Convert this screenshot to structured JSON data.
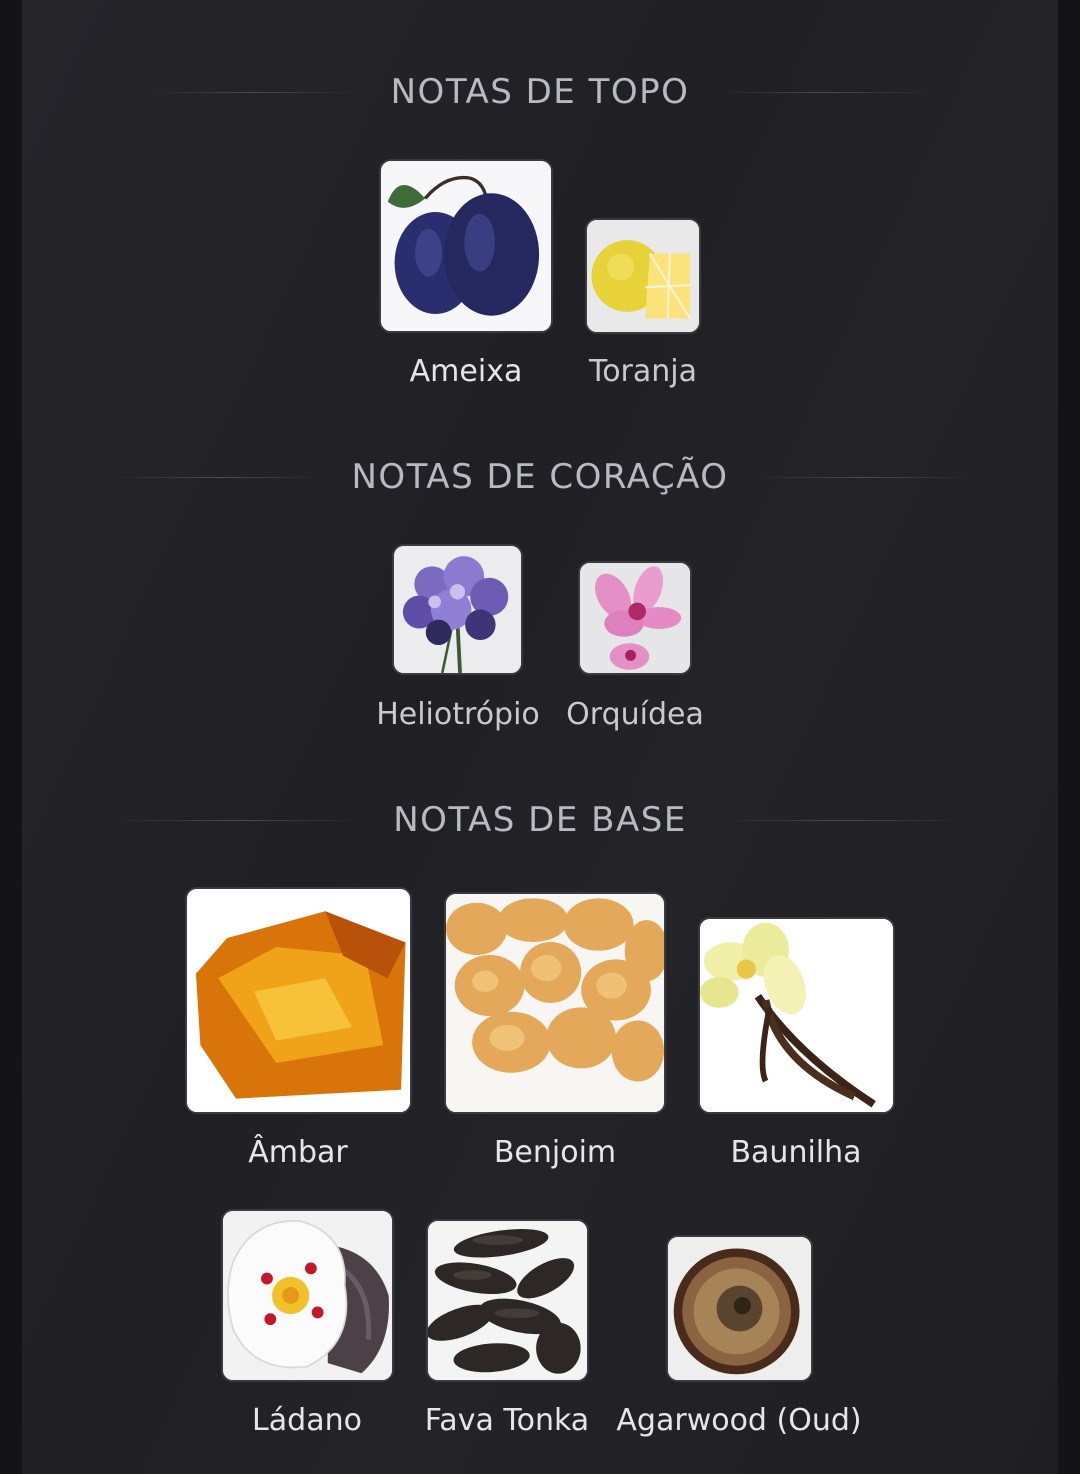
{
  "sections": [
    {
      "title": "NOTAS DE TOPO",
      "notes": [
        {
          "name": "Ameixa",
          "icon": "plum-icon"
        },
        {
          "name": "Toranja",
          "icon": "grapefruit-icon"
        }
      ]
    },
    {
      "title": "NOTAS DE CORAÇÃO",
      "notes": [
        {
          "name": "Heliotrópio",
          "icon": "heliotrope-icon"
        },
        {
          "name": "Orquídea",
          "icon": "orchid-icon"
        }
      ]
    },
    {
      "title": "NOTAS DE BASE",
      "notes": [
        {
          "name": "Âmbar",
          "icon": "amber-icon"
        },
        {
          "name": "Benjoim",
          "icon": "benzoin-icon"
        },
        {
          "name": "Baunilha",
          "icon": "vanilla-icon"
        },
        {
          "name": "Ládano",
          "icon": "labdanum-icon"
        },
        {
          "name": "Fava Tonka",
          "icon": "tonka-bean-icon"
        },
        {
          "name": "Agarwood (Oud)",
          "icon": "agarwood-icon"
        }
      ]
    }
  ],
  "colors": {
    "background": "#141416",
    "panel": "#232327",
    "title_text": "#b9b9c0",
    "label_text": "#e6e6ea"
  }
}
